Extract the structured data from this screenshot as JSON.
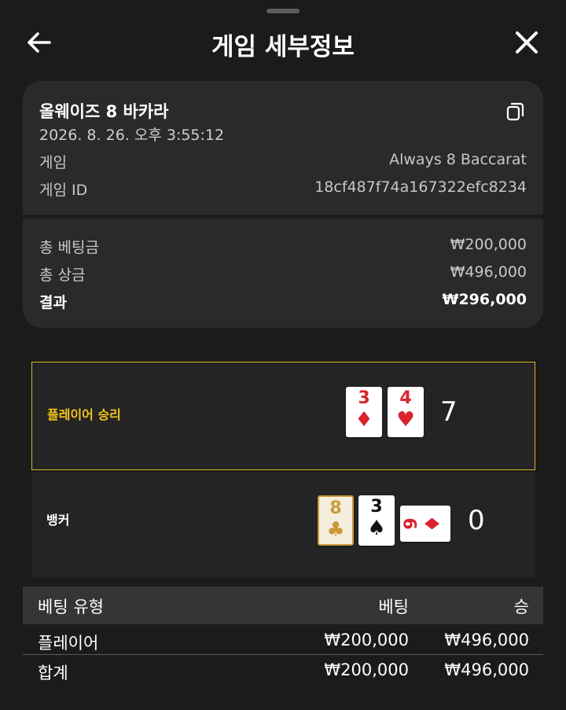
{
  "header": {
    "title": "게임 세부정보",
    "back_icon": "arrow-left-icon",
    "close_icon": "close-icon"
  },
  "info": {
    "game_name": "올웨이즈 8 바카라",
    "date": "2026. 8. 26. 오후 3:55:12",
    "copy_icon": "copy-icon",
    "game_label": "게임",
    "game_value": "Always 8 Baccarat",
    "game_id_label": "게임 ID",
    "game_id_value": "18cf487f74a167322efc8234"
  },
  "summary": {
    "total_bet_label": "총 베팅금",
    "total_bet_value": "₩200,000",
    "total_win_label": "총 상금",
    "total_win_value": "₩496,000",
    "result_label": "결과",
    "result_value": "₩296,000"
  },
  "hands": {
    "player": {
      "label": "플레이어 승리",
      "score": "7",
      "cards": [
        {
          "rank": "3",
          "suit": "♦",
          "color": "#d9232d"
        },
        {
          "rank": "4",
          "suit": "♥",
          "color": "#d9232d"
        }
      ]
    },
    "banker": {
      "label": "뱅커",
      "score": "0",
      "cards": [
        {
          "rank": "8",
          "suit": "♣",
          "color": "#c9993c",
          "style": "gold"
        },
        {
          "rank": "3",
          "suit": "♠",
          "color": "#111111"
        },
        {
          "rank": "9",
          "suit": "♦",
          "color": "#d9232d",
          "orientation": "sideways"
        }
      ]
    }
  },
  "bets_table": {
    "headers": {
      "type": "베팅 유형",
      "bet": "베팅",
      "win": "승"
    },
    "rows": [
      {
        "type": "플레이어",
        "bet": "₩200,000",
        "win": "₩496,000"
      }
    ],
    "total": {
      "type": "합계",
      "bet": "₩200,000",
      "win": "₩496,000"
    }
  },
  "colors": {
    "background": "#1b1b1b",
    "card_bg": "#2a2a2a",
    "player_highlight": "#d9b71f",
    "player_label": "#f2c318"
  }
}
